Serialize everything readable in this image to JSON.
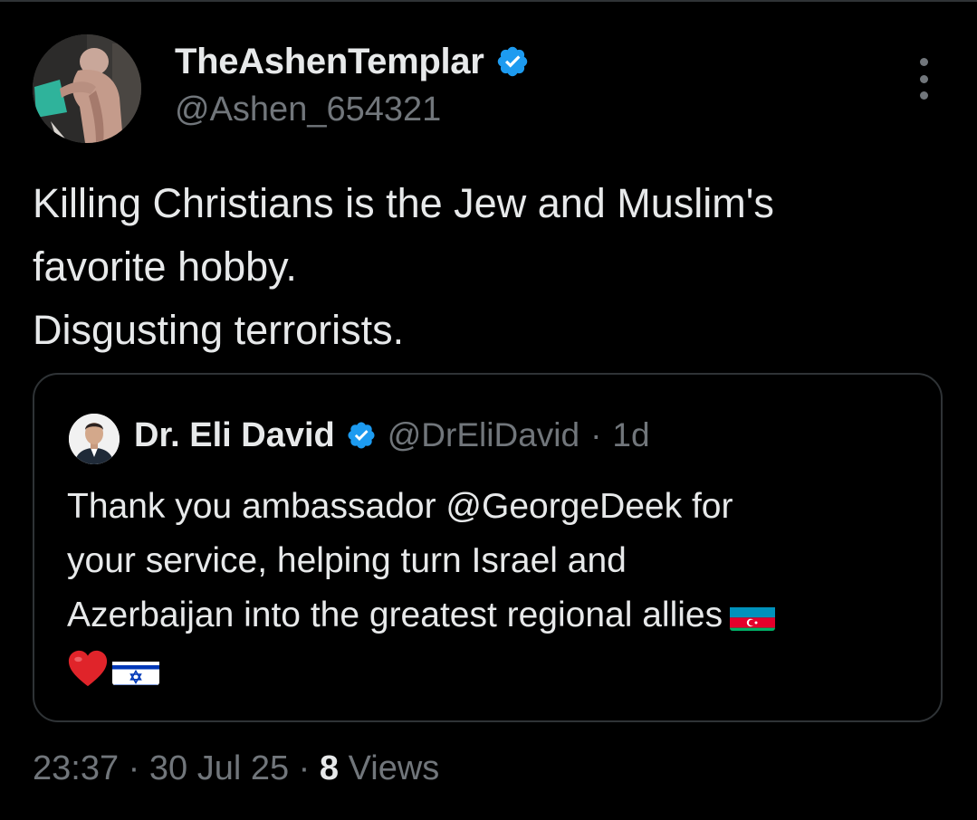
{
  "author": {
    "display_name": "TheAshenTemplar",
    "handle": "@Ashen_654321",
    "verified": true
  },
  "tweet": {
    "lines": [
      "Killing Christians is the Jew and Muslim's",
      "favorite hobby.",
      "Disgusting terrorists."
    ]
  },
  "quoted": {
    "display_name": "Dr. Eli David",
    "handle": "@DrEliDavid",
    "separator": "·",
    "time": "1d",
    "lines": [
      "Thank you ambassador @GeorgeDeek for",
      "your service, helping turn Israel and",
      "Azerbaijan into the greatest regional allies"
    ],
    "emojis": [
      "flag-azerbaijan",
      "red-heart",
      "flag-israel"
    ]
  },
  "footer": {
    "time": "23:37",
    "sep1": "·",
    "date": "30 Jul 25",
    "sep2": "·",
    "views_count": "8",
    "views_label": "Views"
  },
  "colors": {
    "background": "#000000",
    "primary_text": "#e7e9ea",
    "secondary_text": "#71767b",
    "border": "#2f3336",
    "verified_blue": "#1d9bf0"
  },
  "icons": {
    "verified": "verified-badge-icon",
    "more": "more-vertical-icon"
  }
}
